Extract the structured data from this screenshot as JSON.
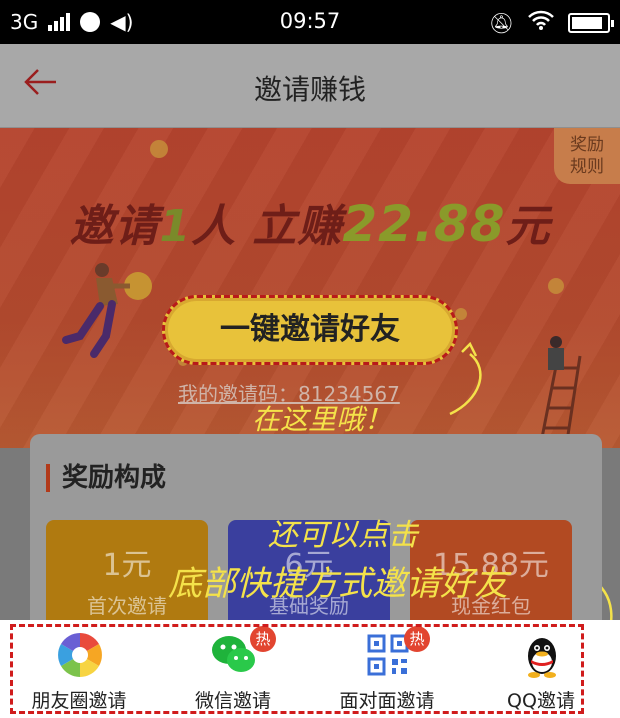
{
  "status_bar": {
    "network": "3G",
    "time": "09:57"
  },
  "nav": {
    "title": "邀请赚钱"
  },
  "banner": {
    "rules_tab_line1": "奖励",
    "rules_tab_line2": "规则",
    "headline_prefix": "邀请",
    "headline_count": "1",
    "headline_mid": "人 立赚",
    "headline_amount": "22.88",
    "headline_unit": "元",
    "invite_button": "一键邀请好友",
    "invite_code_line": "我的邀请码：81234567"
  },
  "annotations": {
    "note_here": "在这里哦！",
    "note_also": "还可以点击",
    "note_bottom": "底部快捷方式邀请好友"
  },
  "reward_section": {
    "title": "奖励构成",
    "cards": [
      {
        "amount": "1元",
        "label": "首次邀请",
        "color": "#b07a10"
      },
      {
        "amount": "6元",
        "label": "基础奖励",
        "color": "#3a3f9e"
      },
      {
        "amount": "15.88元",
        "label": "现金红包",
        "color": "#b24a22"
      }
    ]
  },
  "share_bar": {
    "items": [
      {
        "label": "朋友圈邀请",
        "icon": "moments-icon",
        "hot": ""
      },
      {
        "label": "微信邀请",
        "icon": "wechat-icon",
        "hot": "热"
      },
      {
        "label": "面对面邀请",
        "icon": "qrcode-icon",
        "hot": "热"
      },
      {
        "label": "QQ邀请",
        "icon": "qq-icon",
        "hot": ""
      }
    ]
  }
}
